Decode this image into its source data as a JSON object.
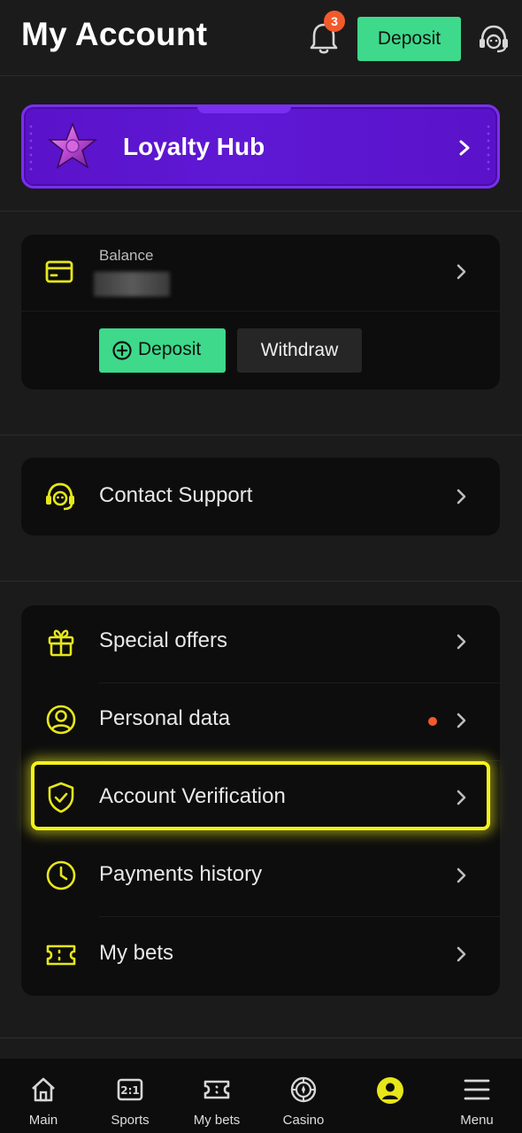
{
  "header": {
    "title": "My Account",
    "notification_count": "3",
    "deposit_label": "Deposit"
  },
  "loyalty": {
    "label": "Loyalty Hub"
  },
  "balance": {
    "label": "Balance",
    "deposit_label": "Deposit",
    "withdraw_label": "Withdraw"
  },
  "support": {
    "label": "Contact Support"
  },
  "menu": {
    "items": [
      {
        "label": "Special offers",
        "icon": "gift-icon"
      },
      {
        "label": "Personal data",
        "icon": "user-circle-icon",
        "has_alert": true
      },
      {
        "label": "Account Verification",
        "icon": "shield-check-icon",
        "highlighted": true
      },
      {
        "label": "Payments history",
        "icon": "clock-icon"
      },
      {
        "label": "My bets",
        "icon": "ticket-icon"
      }
    ]
  },
  "nav": {
    "items": [
      {
        "label": "Main",
        "icon": "home-icon"
      },
      {
        "label": "Sports",
        "icon": "scoreboard-icon"
      },
      {
        "label": "My bets",
        "icon": "ticket-icon"
      },
      {
        "label": "Casino",
        "icon": "roulette-icon"
      },
      {
        "label": "",
        "icon": "user-icon",
        "active": true
      },
      {
        "label": "Menu",
        "icon": "menu-icon"
      }
    ]
  },
  "colors": {
    "accent_green": "#3ed98b",
    "accent_yellow": "#e6e61a",
    "highlight": "#f4f31a",
    "loyalty_purple": "#5f18d4",
    "alert": "#f25a2c"
  }
}
